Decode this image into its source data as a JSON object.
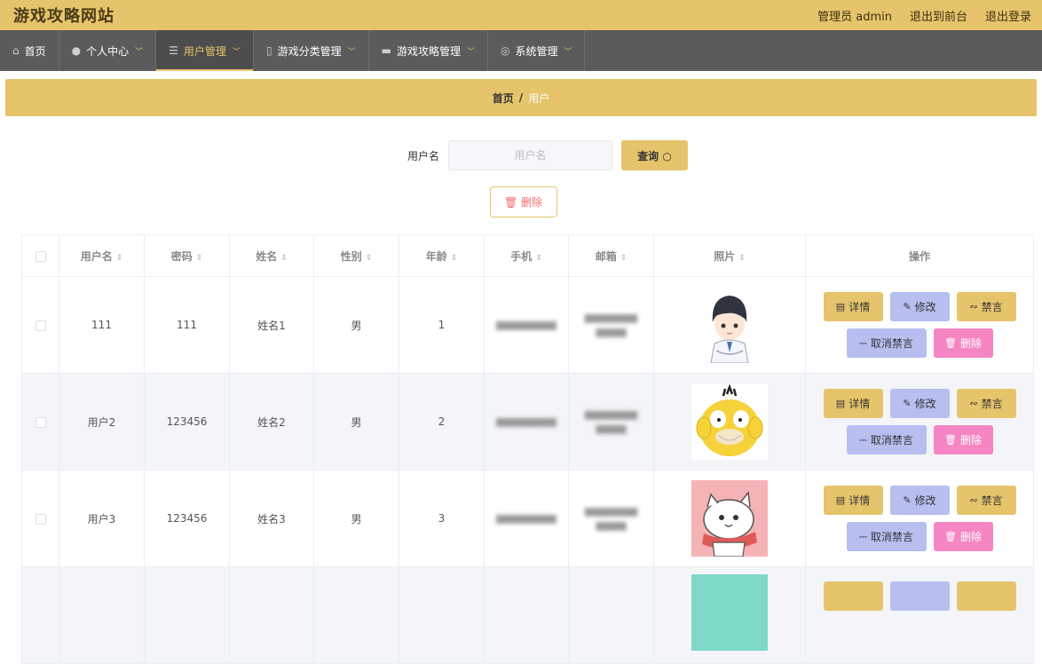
{
  "site": {
    "title": "游戏攻略网站"
  },
  "topnav": {
    "admin": "管理员 admin",
    "back": "退出到前台",
    "logout": "退出登录"
  },
  "menu": [
    {
      "icon": "home-icon",
      "label": "首页",
      "has_dropdown": false,
      "active": false
    },
    {
      "icon": "user-icon",
      "label": "个人中心",
      "has_dropdown": true,
      "active": false
    },
    {
      "icon": "sliders-icon",
      "label": "用户管理",
      "has_dropdown": true,
      "active": true
    },
    {
      "icon": "mic-icon",
      "label": "游戏分类管理",
      "has_dropdown": true,
      "active": false
    },
    {
      "icon": "briefcase-icon",
      "label": "游戏攻略管理",
      "has_dropdown": true,
      "active": false
    },
    {
      "icon": "settings-icon",
      "label": "系统管理",
      "has_dropdown": true,
      "active": false
    }
  ],
  "breadcrumb": {
    "home": "首页",
    "sep": "/",
    "current": "用户"
  },
  "search": {
    "label": "用户名",
    "placeholder": "用户名",
    "value": "",
    "button": "查询"
  },
  "batch_delete": "删除",
  "table": {
    "columns": [
      "用户名",
      "密码",
      "姓名",
      "性别",
      "年龄",
      "手机",
      "邮箱",
      "照片",
      "操作"
    ],
    "rows": [
      {
        "username": "111",
        "password": "111",
        "name": "姓名1",
        "gender": "男",
        "age": "1",
        "avatar": "boy-doctor"
      },
      {
        "username": "用户2",
        "password": "123456",
        "name": "姓名2",
        "gender": "男",
        "age": "2",
        "avatar": "yellow-duck"
      },
      {
        "username": "用户3",
        "password": "123456",
        "name": "姓名3",
        "gender": "男",
        "age": "3",
        "avatar": "white-cat"
      }
    ],
    "actions": {
      "detail": "详情",
      "edit": "修改",
      "mute": "禁言",
      "unmute": "取消禁言",
      "delete": "删除"
    }
  },
  "colors": {
    "accent": "#e6c46b",
    "nav": "#5b5b5b",
    "lavender": "#b7bef0",
    "pink": "#f685c4"
  }
}
